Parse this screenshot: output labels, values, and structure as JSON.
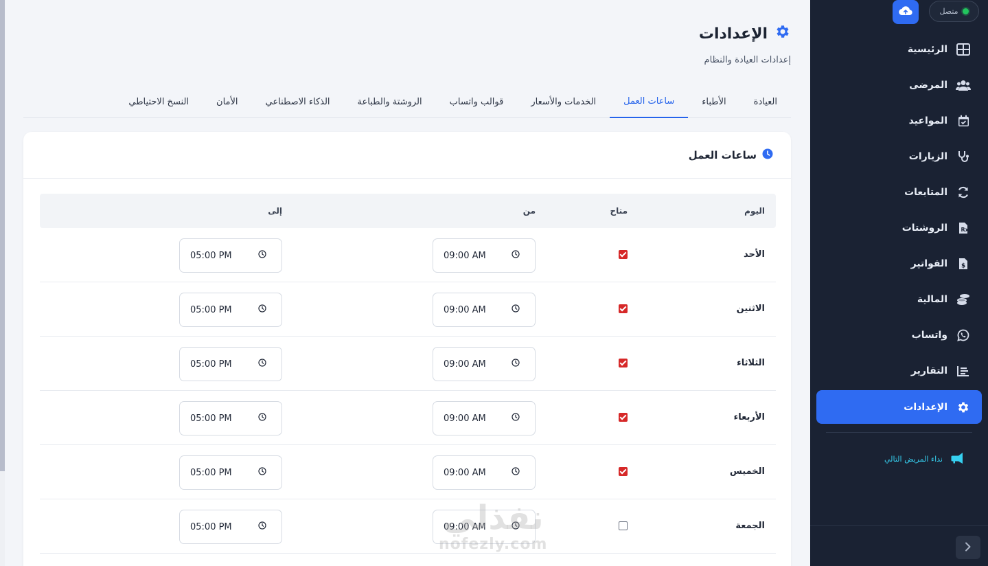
{
  "sidebar": {
    "status_label": "متصل",
    "nav": [
      {
        "label": "الرئيسية",
        "icon": "dashboard-grid-icon"
      },
      {
        "label": "المرضى",
        "icon": "users-icon"
      },
      {
        "label": "المواعيد",
        "icon": "calendar-check-icon"
      },
      {
        "label": "الزيارات",
        "icon": "stethoscope-icon"
      },
      {
        "label": "المتابعات",
        "icon": "refresh-icon"
      },
      {
        "label": "الروشتات",
        "icon": "prescription-icon"
      },
      {
        "label": "الفواتير",
        "icon": "invoice-icon"
      },
      {
        "label": "المالية",
        "icon": "coins-icon"
      },
      {
        "label": "واتساب",
        "icon": "whatsapp-icon"
      },
      {
        "label": "التقارير",
        "icon": "bar-chart-icon"
      },
      {
        "label": "الإعدادات",
        "icon": "gear-icon",
        "active": true
      }
    ],
    "call_next": "نداء المريض التالي"
  },
  "header": {
    "title": "الإعدادات",
    "subtitle": "إعدادات العيادة والنظام"
  },
  "tabs": [
    "العيادة",
    "الأطباء",
    "ساعات العمل",
    "الخدمات والأسعار",
    "قوالب واتساب",
    "الروشتة والطباعة",
    "الذكاء الاصطناعي",
    "الأمان",
    "النسخ الاحتياطي"
  ],
  "active_tab": "ساعات العمل",
  "card": {
    "title": "ساعات العمل",
    "columns": {
      "day": "اليوم",
      "available": "متاح",
      "from": "من",
      "to": "إلى"
    },
    "rows": [
      {
        "day": "الأحد",
        "available": true,
        "from": "09:00 AM",
        "to": "05:00 PM"
      },
      {
        "day": "الاثنين",
        "available": true,
        "from": "09:00 AM",
        "to": "05:00 PM"
      },
      {
        "day": "الثلاثاء",
        "available": true,
        "from": "09:00 AM",
        "to": "05:00 PM"
      },
      {
        "day": "الأربعاء",
        "available": true,
        "from": "09:00 AM",
        "to": "05:00 PM"
      },
      {
        "day": "الخميس",
        "available": true,
        "from": "09:00 AM",
        "to": "05:00 PM"
      },
      {
        "day": "الجمعة",
        "available": false,
        "from": "09:00 AM",
        "to": "05:00 PM"
      }
    ]
  },
  "watermark": {
    "line1": "نفذلي",
    "line2": "nofezly.com"
  },
  "colors": {
    "accent": "#2f6bf2",
    "sidebar_bg": "#1a2233",
    "checkbox": "#d62828",
    "online": "#22c55e",
    "call_next": "#36d0f0"
  }
}
